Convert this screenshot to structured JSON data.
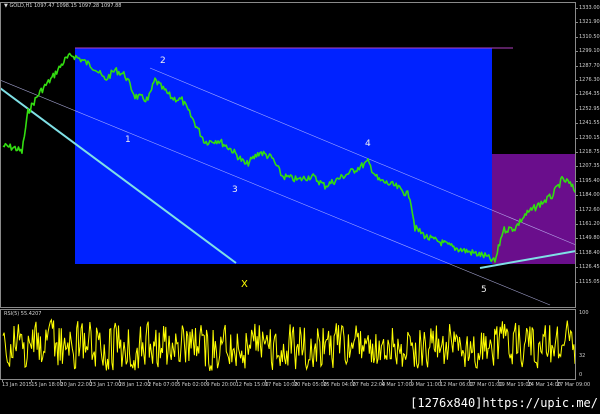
{
  "chart_info": {
    "symbol_line": "GOLD,H1  1097.47  1098.15  1097.28  1097.88",
    "rsi_line": "RSI(5) 55.4207"
  },
  "price_ticks": [
    "1333.00",
    "1321.90",
    "1310.50",
    "1299.10",
    "1287.70",
    "1276.30",
    "1264.35",
    "1252.95",
    "1241.55",
    "1230.15",
    "1218.75",
    "1207.35",
    "1195.40",
    "1184.00",
    "1172.60",
    "1161.20",
    "1149.80",
    "1138.40",
    "1126.45",
    "1115.05"
  ],
  "rsi_ticks": {
    "top": "100",
    "mid": "32",
    "bottom": "0"
  },
  "time_ticks": [
    "13 Jan 2015",
    "15 Jan 18:00",
    "20 Jan 22:00",
    "23 Jan 17:00",
    "28 Jan 12:00",
    "2 Feb 07:00",
    "5 Feb 02:00",
    "9 Feb 20:00",
    "12 Feb 15:00",
    "17 Feb 10:00",
    "20 Feb 05:00",
    "25 Feb 04:00",
    "27 Feb 22:00",
    "4 Mar 17:00",
    "9 Mar 11:00",
    "12 Mar 06:00",
    "17 Mar 01:00",
    "19 Mar 19:00",
    "24 Mar 14:00",
    "27 Mar 09:00"
  ],
  "wave_labels": {
    "w1": "1",
    "w2": "2",
    "w3": "3",
    "w4": "4",
    "w5": "5",
    "wx": "X"
  },
  "colors": {
    "blue_zone": "#0022ff",
    "purple_zone": "#6a0e8c",
    "price_line": "#33dd11",
    "rsi_line": "#ffff00",
    "trendline": "#7fe0e6",
    "channel": "#c8c8ff"
  },
  "watermark": "[1276x840]https://upic.me/"
}
